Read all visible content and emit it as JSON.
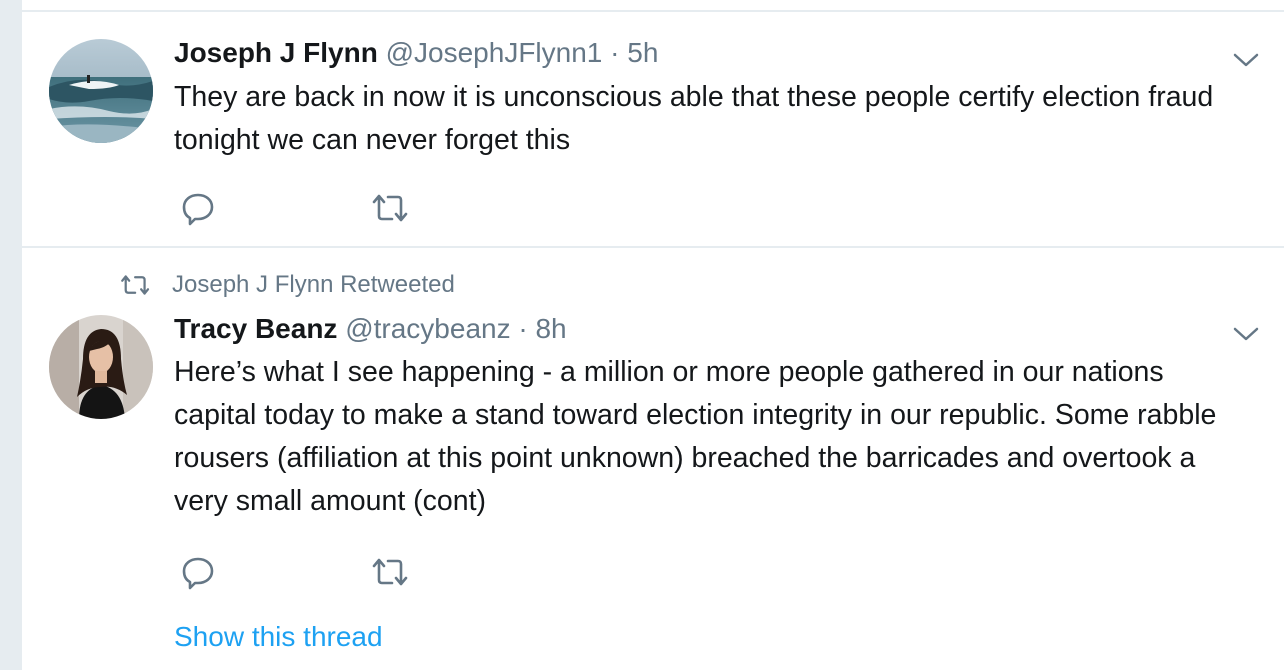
{
  "colors": {
    "text_primary": "#14171a",
    "text_secondary": "#657786",
    "divider": "#e6ecf0",
    "link": "#1da1f2"
  },
  "tweets": [
    {
      "author_name": "Joseph J Flynn",
      "handle": "@JosephJFlynn1",
      "separator": "·",
      "time": "5h",
      "text": "They are back in now it is unconscious able that these people certify election fraud tonight we can never forget this",
      "avatar_icon": "surfer-wave-avatar",
      "icons": [
        "reply-icon",
        "retweet-icon",
        "chevron-down-icon"
      ]
    },
    {
      "retweet_context": "Joseph J Flynn Retweeted",
      "author_name": "Tracy Beanz",
      "handle": "@tracybeanz",
      "separator": "·",
      "time": "8h",
      "text": "Here’s what I see happening - a million or more people gathered in our nations capital today to make a stand toward election integrity in our republic. Some rabble rousers (affiliation at this point unknown) breached the barricades and overtook a very small amount (cont)",
      "avatar_icon": "woman-portrait-avatar",
      "show_thread": "Show this thread",
      "icons": [
        "reply-icon",
        "retweet-icon",
        "chevron-down-icon"
      ]
    }
  ]
}
